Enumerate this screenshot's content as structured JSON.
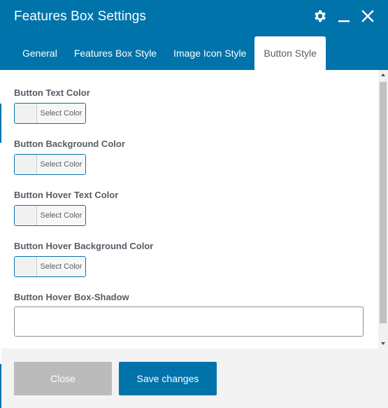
{
  "header": {
    "title": "Features Box Settings",
    "icons": [
      "gear-icon",
      "minimize-icon",
      "close-icon"
    ]
  },
  "tabs": [
    {
      "label": "General",
      "active": false
    },
    {
      "label": "Features Box Style",
      "active": false
    },
    {
      "label": "Image Icon Style",
      "active": false
    },
    {
      "label": "Button Style",
      "active": true
    }
  ],
  "fields": {
    "button_text_color": {
      "label": "Button Text Color",
      "button": "Select Color"
    },
    "button_background_color": {
      "label": "Button Background Color",
      "button": "Select Color"
    },
    "button_hover_text_color": {
      "label": "Button Hover Text Color",
      "button": "Select Color"
    },
    "button_hover_background_color": {
      "label": "Button Hover Background Color",
      "button": "Select Color"
    },
    "button_hover_box_shadow": {
      "label": "Button Hover Box-Shadow",
      "value": ""
    }
  },
  "footer": {
    "close_label": "Close",
    "save_label": "Save changes"
  },
  "colors": {
    "accent": "#0073aa",
    "close_button": "#bbbbbb",
    "label_text": "#555d66"
  }
}
